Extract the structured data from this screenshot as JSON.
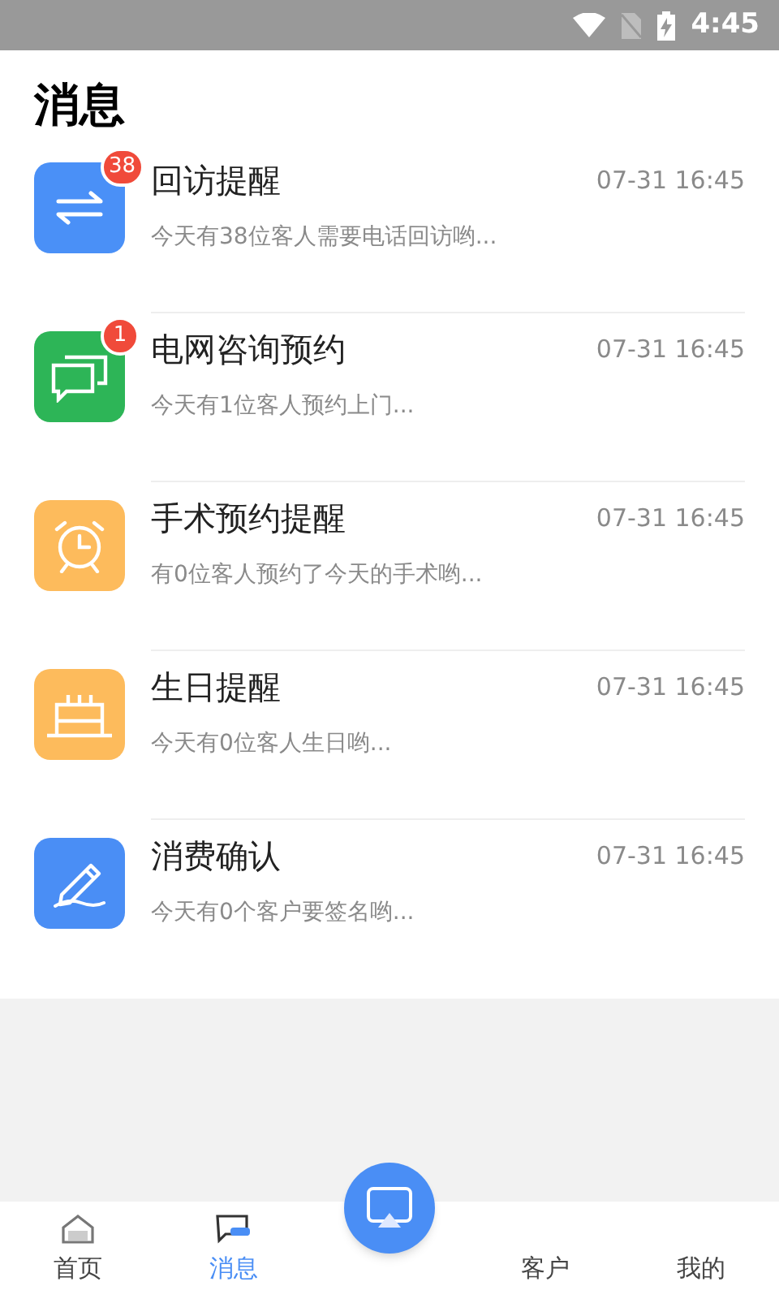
{
  "status_bar": {
    "time": "4:45"
  },
  "header": {
    "title": "消息"
  },
  "messages": [
    {
      "kind": "arrows",
      "color": "#4a90f7",
      "badge": "38",
      "title": "回访提醒",
      "time": "07-31 16:45",
      "preview": "今天有38位客人需要电话回访哟..."
    },
    {
      "kind": "chat",
      "color": "#2db557",
      "badge": "1",
      "title": "电网咨询预约",
      "time": "07-31 16:45",
      "preview": "今天有1位客人预约上门..."
    },
    {
      "kind": "alarm",
      "color": "#fdbb5c",
      "title": "手术预约提醒",
      "time": "07-31 16:45",
      "preview": "有0位客人预约了今天的手术哟..."
    },
    {
      "kind": "cake",
      "color": "#fdbb5c",
      "title": "生日提醒",
      "time": "07-31 16:45",
      "preview": "今天有0位客人生日哟..."
    },
    {
      "kind": "pen",
      "color": "#4a8ef5",
      "title": "消费确认",
      "time": "07-31 16:45",
      "preview": "今天有0个客户要签名哟..."
    }
  ],
  "tab_bar": [
    {
      "kind": "home",
      "label": "首页",
      "selected": false
    },
    {
      "kind": "chat",
      "label": "消息",
      "selected": true
    },
    {
      "label": "客户",
      "selected": false
    },
    {
      "label": "我的",
      "selected": false
    }
  ]
}
